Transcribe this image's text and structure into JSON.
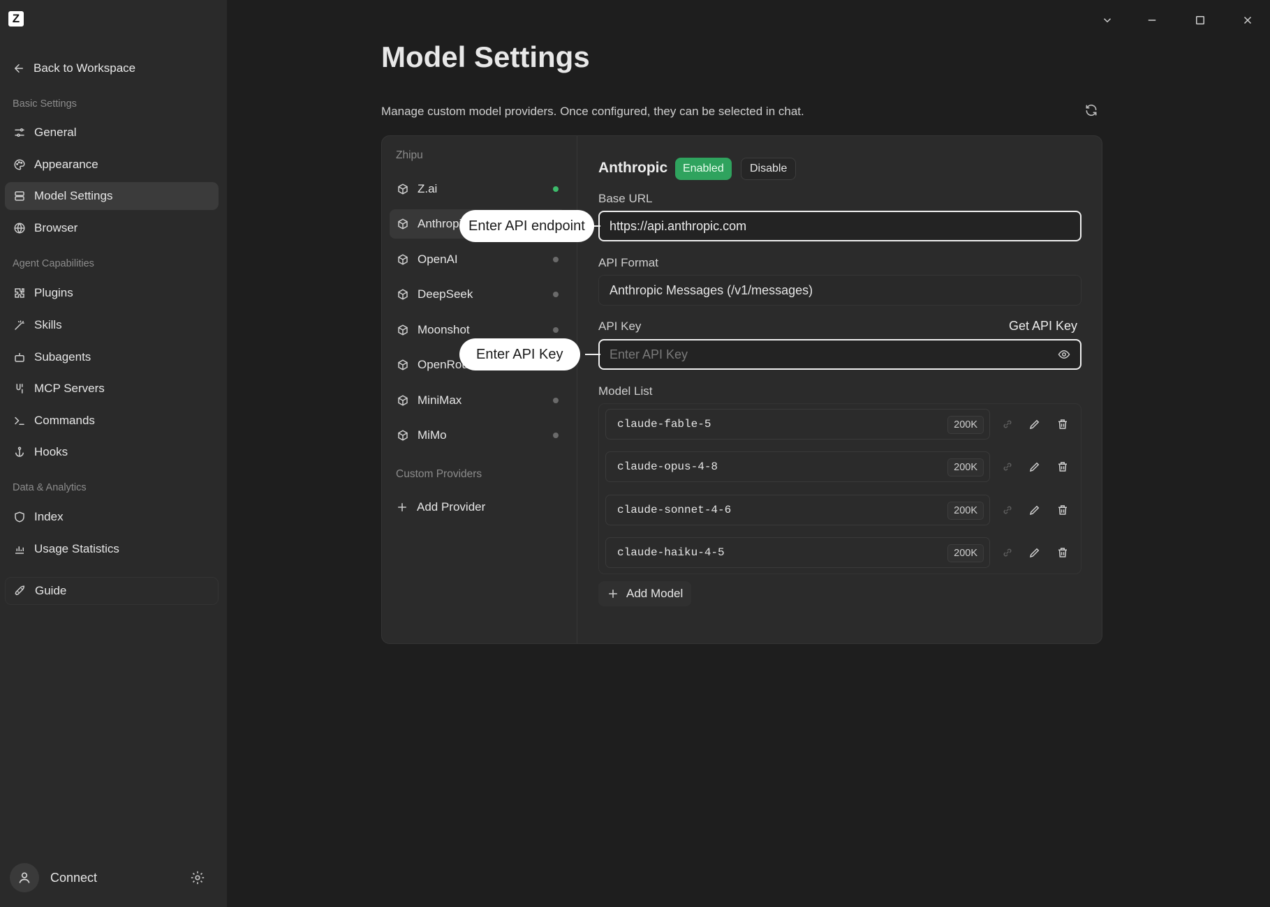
{
  "app": {
    "logo_letter": "Z"
  },
  "sidebar": {
    "back_label": "Back to Workspace",
    "sections": {
      "basic": "Basic Settings",
      "agent": "Agent Capabilities",
      "data": "Data & Analytics"
    },
    "items": [
      {
        "label": "General",
        "icon": "sliders-icon"
      },
      {
        "label": "Appearance",
        "icon": "palette-icon"
      },
      {
        "label": "Model Settings",
        "icon": "database-icon",
        "active": true
      },
      {
        "label": "Browser",
        "icon": "globe-icon"
      },
      {
        "label": "Plugins",
        "icon": "puzzle-icon"
      },
      {
        "label": "Skills",
        "icon": "wand-icon"
      },
      {
        "label": "Subagents",
        "icon": "bot-icon"
      },
      {
        "label": "MCP Servers",
        "icon": "plug-icon"
      },
      {
        "label": "Commands",
        "icon": "terminal-icon"
      },
      {
        "label": "Hooks",
        "icon": "anchor-icon"
      },
      {
        "label": "Index",
        "icon": "shield-icon"
      },
      {
        "label": "Usage Statistics",
        "icon": "bar-chart-icon"
      },
      {
        "label": "Guide",
        "icon": "rocket-icon"
      }
    ],
    "connect_label": "Connect"
  },
  "main": {
    "title": "Model Settings",
    "subtitle": "Manage custom model providers. Once configured, they can be selected in chat."
  },
  "providers": {
    "group_label": "Zhipu",
    "custom_label": "Custom Providers",
    "add_provider_label": "Add Provider",
    "items": [
      {
        "label": "Z.ai",
        "enabled": true
      },
      {
        "label": "Anthropic",
        "active": true
      },
      {
        "label": "OpenAI",
        "enabled": false
      },
      {
        "label": "DeepSeek",
        "enabled": false
      },
      {
        "label": "Moonshot",
        "enabled": false
      },
      {
        "label": "OpenRouter",
        "enabled": false
      },
      {
        "label": "MiniMax",
        "enabled": false
      },
      {
        "label": "MiMo",
        "enabled": false
      }
    ]
  },
  "detail": {
    "provider_name": "Anthropic",
    "status_badge": "Enabled",
    "disable_label": "Disable",
    "base_url_label": "Base URL",
    "base_url_value": "https://api.anthropic.com",
    "api_format_label": "API Format",
    "api_format_value": "Anthropic Messages (/v1/messages)",
    "api_key_label": "API Key",
    "api_key_placeholder": "Enter API Key",
    "get_api_key_label": "Get API Key",
    "model_list_label": "Model List",
    "models": [
      {
        "name": "claude-fable-5",
        "context": "200K"
      },
      {
        "name": "claude-opus-4-8",
        "context": "200K"
      },
      {
        "name": "claude-sonnet-4-6",
        "context": "200K"
      },
      {
        "name": "claude-haiku-4-5",
        "context": "200K"
      }
    ],
    "add_model_label": "Add Model"
  },
  "callouts": {
    "endpoint": "Enter API endpoint",
    "api_key": "Enter API Key"
  },
  "colors": {
    "background": "#1e1e1e",
    "sidebar": "#2a2a2a",
    "accent_green": "#2fa35e",
    "status_on": "#3dbb6b"
  }
}
